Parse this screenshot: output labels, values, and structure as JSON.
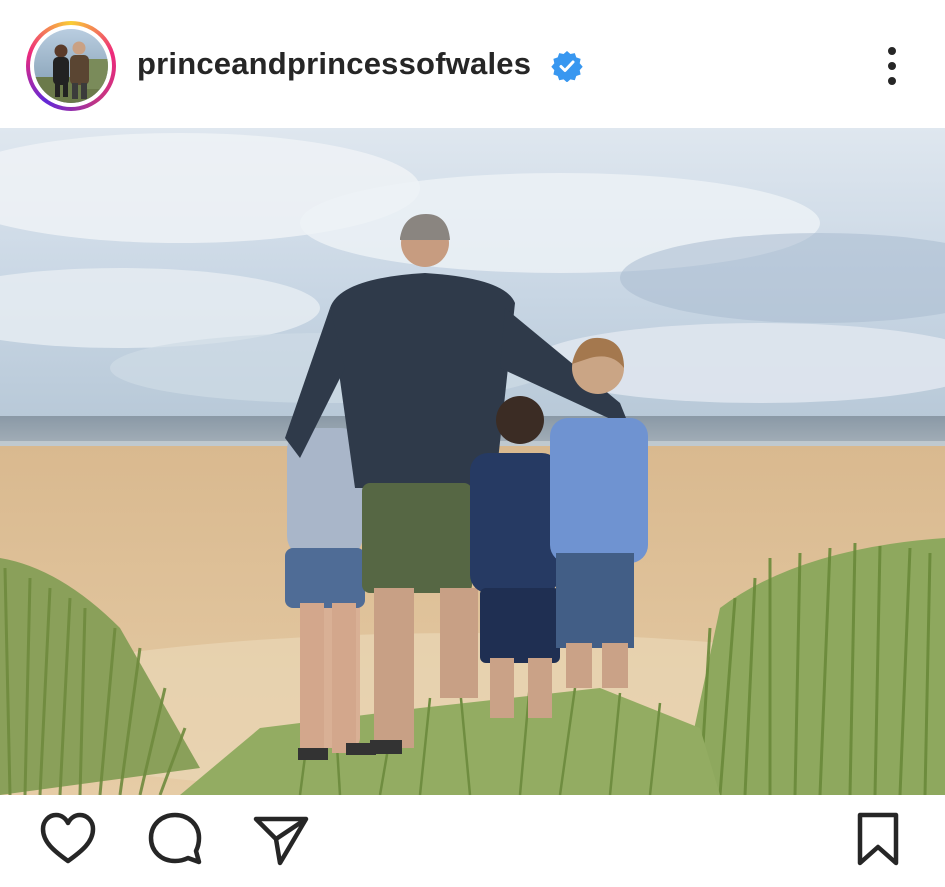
{
  "post": {
    "username": "princeandprincessofwales",
    "verified": true,
    "avatar_description": "avatar-photo-couple",
    "photo_subject": "family-on-beach-dunes"
  },
  "icons": {
    "more": "more-vertical-icon",
    "like": "heart-icon",
    "comment": "comment-bubble-icon",
    "share": "paper-plane-icon",
    "save": "bookmark-icon"
  },
  "colors": {
    "text": "#262626",
    "verified_badge": "#3897f0",
    "background": "#ffffff"
  }
}
